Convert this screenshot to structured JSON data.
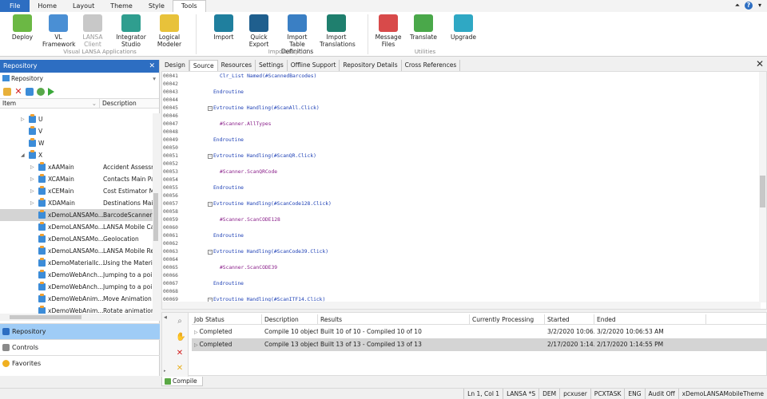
{
  "menubar": {
    "items": [
      "File",
      "Home",
      "Layout",
      "Theme",
      "Style",
      "Tools"
    ],
    "active": "Tools"
  },
  "ribbon": {
    "buttons": [
      {
        "label": "Deploy",
        "icon": "deploy-icon",
        "color": "#6bb844"
      },
      {
        "label": "VL\nFramework",
        "icon": "vl-framework-icon",
        "color": "#4a8fd4"
      },
      {
        "label": "LANSA\nClient",
        "icon": "lansa-client-icon",
        "color": "#c8c8c8",
        "disabled": true
      },
      {
        "label": "Integrator\nStudio",
        "icon": "integrator-studio-icon",
        "color": "#2f9e8f"
      },
      {
        "label": "Logical\nModeler",
        "icon": "logical-modeler-icon",
        "color": "#e8c23a"
      },
      {
        "label": "Import",
        "icon": "import-icon",
        "color": "#1f7f9e"
      },
      {
        "label": "Quick Export",
        "icon": "quick-export-icon",
        "color": "#1f5f8e"
      },
      {
        "label": "Import Table\nDefinitions",
        "icon": "import-table-icon",
        "color": "#3a7fc4"
      },
      {
        "label": "Import\nTranslations",
        "icon": "import-translations-icon",
        "color": "#1f7f6e"
      },
      {
        "label": "Message\nFiles",
        "icon": "message-files-icon",
        "color": "#d84a4a"
      },
      {
        "label": "Translate",
        "icon": "translate-icon",
        "color": "#4aa84a"
      },
      {
        "label": "Upgrade",
        "icon": "upgrade-icon",
        "color": "#2fa8c4"
      }
    ],
    "groups": [
      "Visual LANSA Applications",
      "Import/Export",
      "Utilities"
    ]
  },
  "repository": {
    "title": "Repository",
    "combo": "Repository",
    "columns": [
      "Item",
      "Description"
    ],
    "tree": [
      {
        "name": "U",
        "desc": "",
        "level": 0,
        "exp": "▷"
      },
      {
        "name": "V",
        "desc": "",
        "level": 0,
        "exp": ""
      },
      {
        "name": "W",
        "desc": "",
        "level": 0,
        "exp": ""
      },
      {
        "name": "X",
        "desc": "",
        "level": 0,
        "exp": "◢"
      },
      {
        "name": "xAAMain",
        "desc": "Accident Assessme",
        "level": 1,
        "exp": "▷"
      },
      {
        "name": "XCAMain",
        "desc": "Contacts Main Pag",
        "level": 1,
        "exp": "▷"
      },
      {
        "name": "xCEMain",
        "desc": "Cost Estimator Ma",
        "level": 1,
        "exp": "▷"
      },
      {
        "name": "XDAMain",
        "desc": "Destinations Main",
        "level": 1,
        "exp": "▷"
      },
      {
        "name": "xDemoLANSAMo...",
        "desc": "BarcodeScanner",
        "level": 1,
        "exp": "",
        "selected": true
      },
      {
        "name": "xDemoLANSAMo...",
        "desc": "LANSA Mobile Car",
        "level": 1,
        "exp": ""
      },
      {
        "name": "xDemoLANSAMo...",
        "desc": "Geolocation",
        "level": 1,
        "exp": ""
      },
      {
        "name": "xDemoLANSAMo...",
        "desc": "LANSA Mobile Rec",
        "level": 1,
        "exp": ""
      },
      {
        "name": "xDemoMaterialIc...",
        "desc": "Using the Material",
        "level": 1,
        "exp": ""
      },
      {
        "name": "xDemoWebAnch...",
        "desc": "Jumping to a poin",
        "level": 1,
        "exp": ""
      },
      {
        "name": "xDemoWebAnch...",
        "desc": "Jumping to a poin",
        "level": 1,
        "exp": ""
      },
      {
        "name": "xDemoWebAnim...",
        "desc": "Move Animation",
        "level": 1,
        "exp": ""
      },
      {
        "name": "xDemoWebAnim...",
        "desc": "Rotate animation",
        "level": 1,
        "exp": ""
      }
    ]
  },
  "nav": [
    "Repository",
    "Controls",
    "Favorites"
  ],
  "editor": {
    "tabs": [
      "Design",
      "Source",
      "Resources",
      "Settings",
      "Offline Support",
      "Repository Details",
      "Cross References"
    ],
    "active_tab": "Source",
    "lines": [
      {
        "n": "00041",
        "code": "Clr_List Named(#ScannedBarcodes)",
        "indent": 2,
        "fold": false,
        "kind": "kw"
      },
      {
        "n": "00042",
        "code": "",
        "indent": 0,
        "fold": false,
        "kind": "kw"
      },
      {
        "n": "00043",
        "code": "Endroutine",
        "indent": 1,
        "fold": false,
        "kind": "kw"
      },
      {
        "n": "00044",
        "code": "",
        "indent": 0,
        "fold": false,
        "kind": "kw"
      },
      {
        "n": "00045",
        "code": "Evtroutine Handling(#ScanAll.Click)",
        "indent": 1,
        "fold": true,
        "kind": "kw"
      },
      {
        "n": "00046",
        "code": "",
        "indent": 0,
        "fold": false,
        "kind": "kw"
      },
      {
        "n": "00047",
        "code": "#Scanner.AllTypes",
        "indent": 2,
        "fold": false,
        "kind": "cm"
      },
      {
        "n": "00048",
        "code": "",
        "indent": 0,
        "fold": false,
        "kind": "kw"
      },
      {
        "n": "00049",
        "code": "Endroutine",
        "indent": 1,
        "fold": false,
        "kind": "kw"
      },
      {
        "n": "00050",
        "code": "",
        "indent": 0,
        "fold": false,
        "kind": "kw"
      },
      {
        "n": "00051",
        "code": "Evtroutine Handling(#ScanQR.Click)",
        "indent": 1,
        "fold": true,
        "kind": "kw"
      },
      {
        "n": "00052",
        "code": "",
        "indent": 0,
        "fold": false,
        "kind": "kw"
      },
      {
        "n": "00053",
        "code": "#Scanner.ScanQRCode",
        "indent": 2,
        "fold": false,
        "kind": "cm"
      },
      {
        "n": "00054",
        "code": "",
        "indent": 0,
        "fold": false,
        "kind": "kw"
      },
      {
        "n": "00055",
        "code": "Endroutine",
        "indent": 1,
        "fold": false,
        "kind": "kw"
      },
      {
        "n": "00056",
        "code": "",
        "indent": 0,
        "fold": false,
        "kind": "kw"
      },
      {
        "n": "00057",
        "code": "Evtroutine Handling(#ScanCode128.Click)",
        "indent": 1,
        "fold": true,
        "kind": "kw"
      },
      {
        "n": "00058",
        "code": "",
        "indent": 0,
        "fold": false,
        "kind": "kw"
      },
      {
        "n": "00059",
        "code": "#Scanner.ScanCODE128",
        "indent": 2,
        "fold": false,
        "kind": "cm"
      },
      {
        "n": "00060",
        "code": "",
        "indent": 0,
        "fold": false,
        "kind": "kw"
      },
      {
        "n": "00061",
        "code": "Endroutine",
        "indent": 1,
        "fold": false,
        "kind": "kw"
      },
      {
        "n": "00062",
        "code": "",
        "indent": 0,
        "fold": false,
        "kind": "kw"
      },
      {
        "n": "00063",
        "code": "Evtroutine Handling(#ScanCode39.Click)",
        "indent": 1,
        "fold": true,
        "kind": "kw"
      },
      {
        "n": "00064",
        "code": "",
        "indent": 0,
        "fold": false,
        "kind": "kw"
      },
      {
        "n": "00065",
        "code": "#Scanner.ScanCODE39",
        "indent": 2,
        "fold": false,
        "kind": "cm"
      },
      {
        "n": "00066",
        "code": "",
        "indent": 0,
        "fold": false,
        "kind": "kw"
      },
      {
        "n": "00067",
        "code": "Endroutine",
        "indent": 1,
        "fold": false,
        "kind": "kw"
      },
      {
        "n": "00068",
        "code": "",
        "indent": 0,
        "fold": false,
        "kind": "kw"
      },
      {
        "n": "00069",
        "code": "Evtroutine Handling(#ScanITF14.Click)",
        "indent": 1,
        "fold": true,
        "kind": "kw"
      }
    ]
  },
  "jobs": {
    "columns": [
      "Job Status",
      "Description",
      "Results",
      "Currently Processing",
      "Started",
      "Ended"
    ],
    "rows": [
      {
        "status": "Completed",
        "description": "Compile 10 objects",
        "results": "Built 10 of 10 - Compiled 10 of 10",
        "processing": "",
        "started": "3/2/2020 10:06...",
        "ended": "3/2/2020 10:06:53 AM",
        "selected": false
      },
      {
        "status": "Completed",
        "description": "Compile 13 objects",
        "results": "Built 13 of 13 - Compiled 13 of 13",
        "processing": "",
        "started": "2/17/2020 1:14...",
        "ended": "2/17/2020 1:14:55 PM",
        "selected": true
      }
    ],
    "tab": "Compile"
  },
  "status": [
    "Ln 1, Col 1",
    "LANSA *S",
    "DEM",
    "pcxuser",
    "PCXTASK",
    "ENG",
    "Audit Off",
    "xDemoLANSAMobileTheme"
  ]
}
